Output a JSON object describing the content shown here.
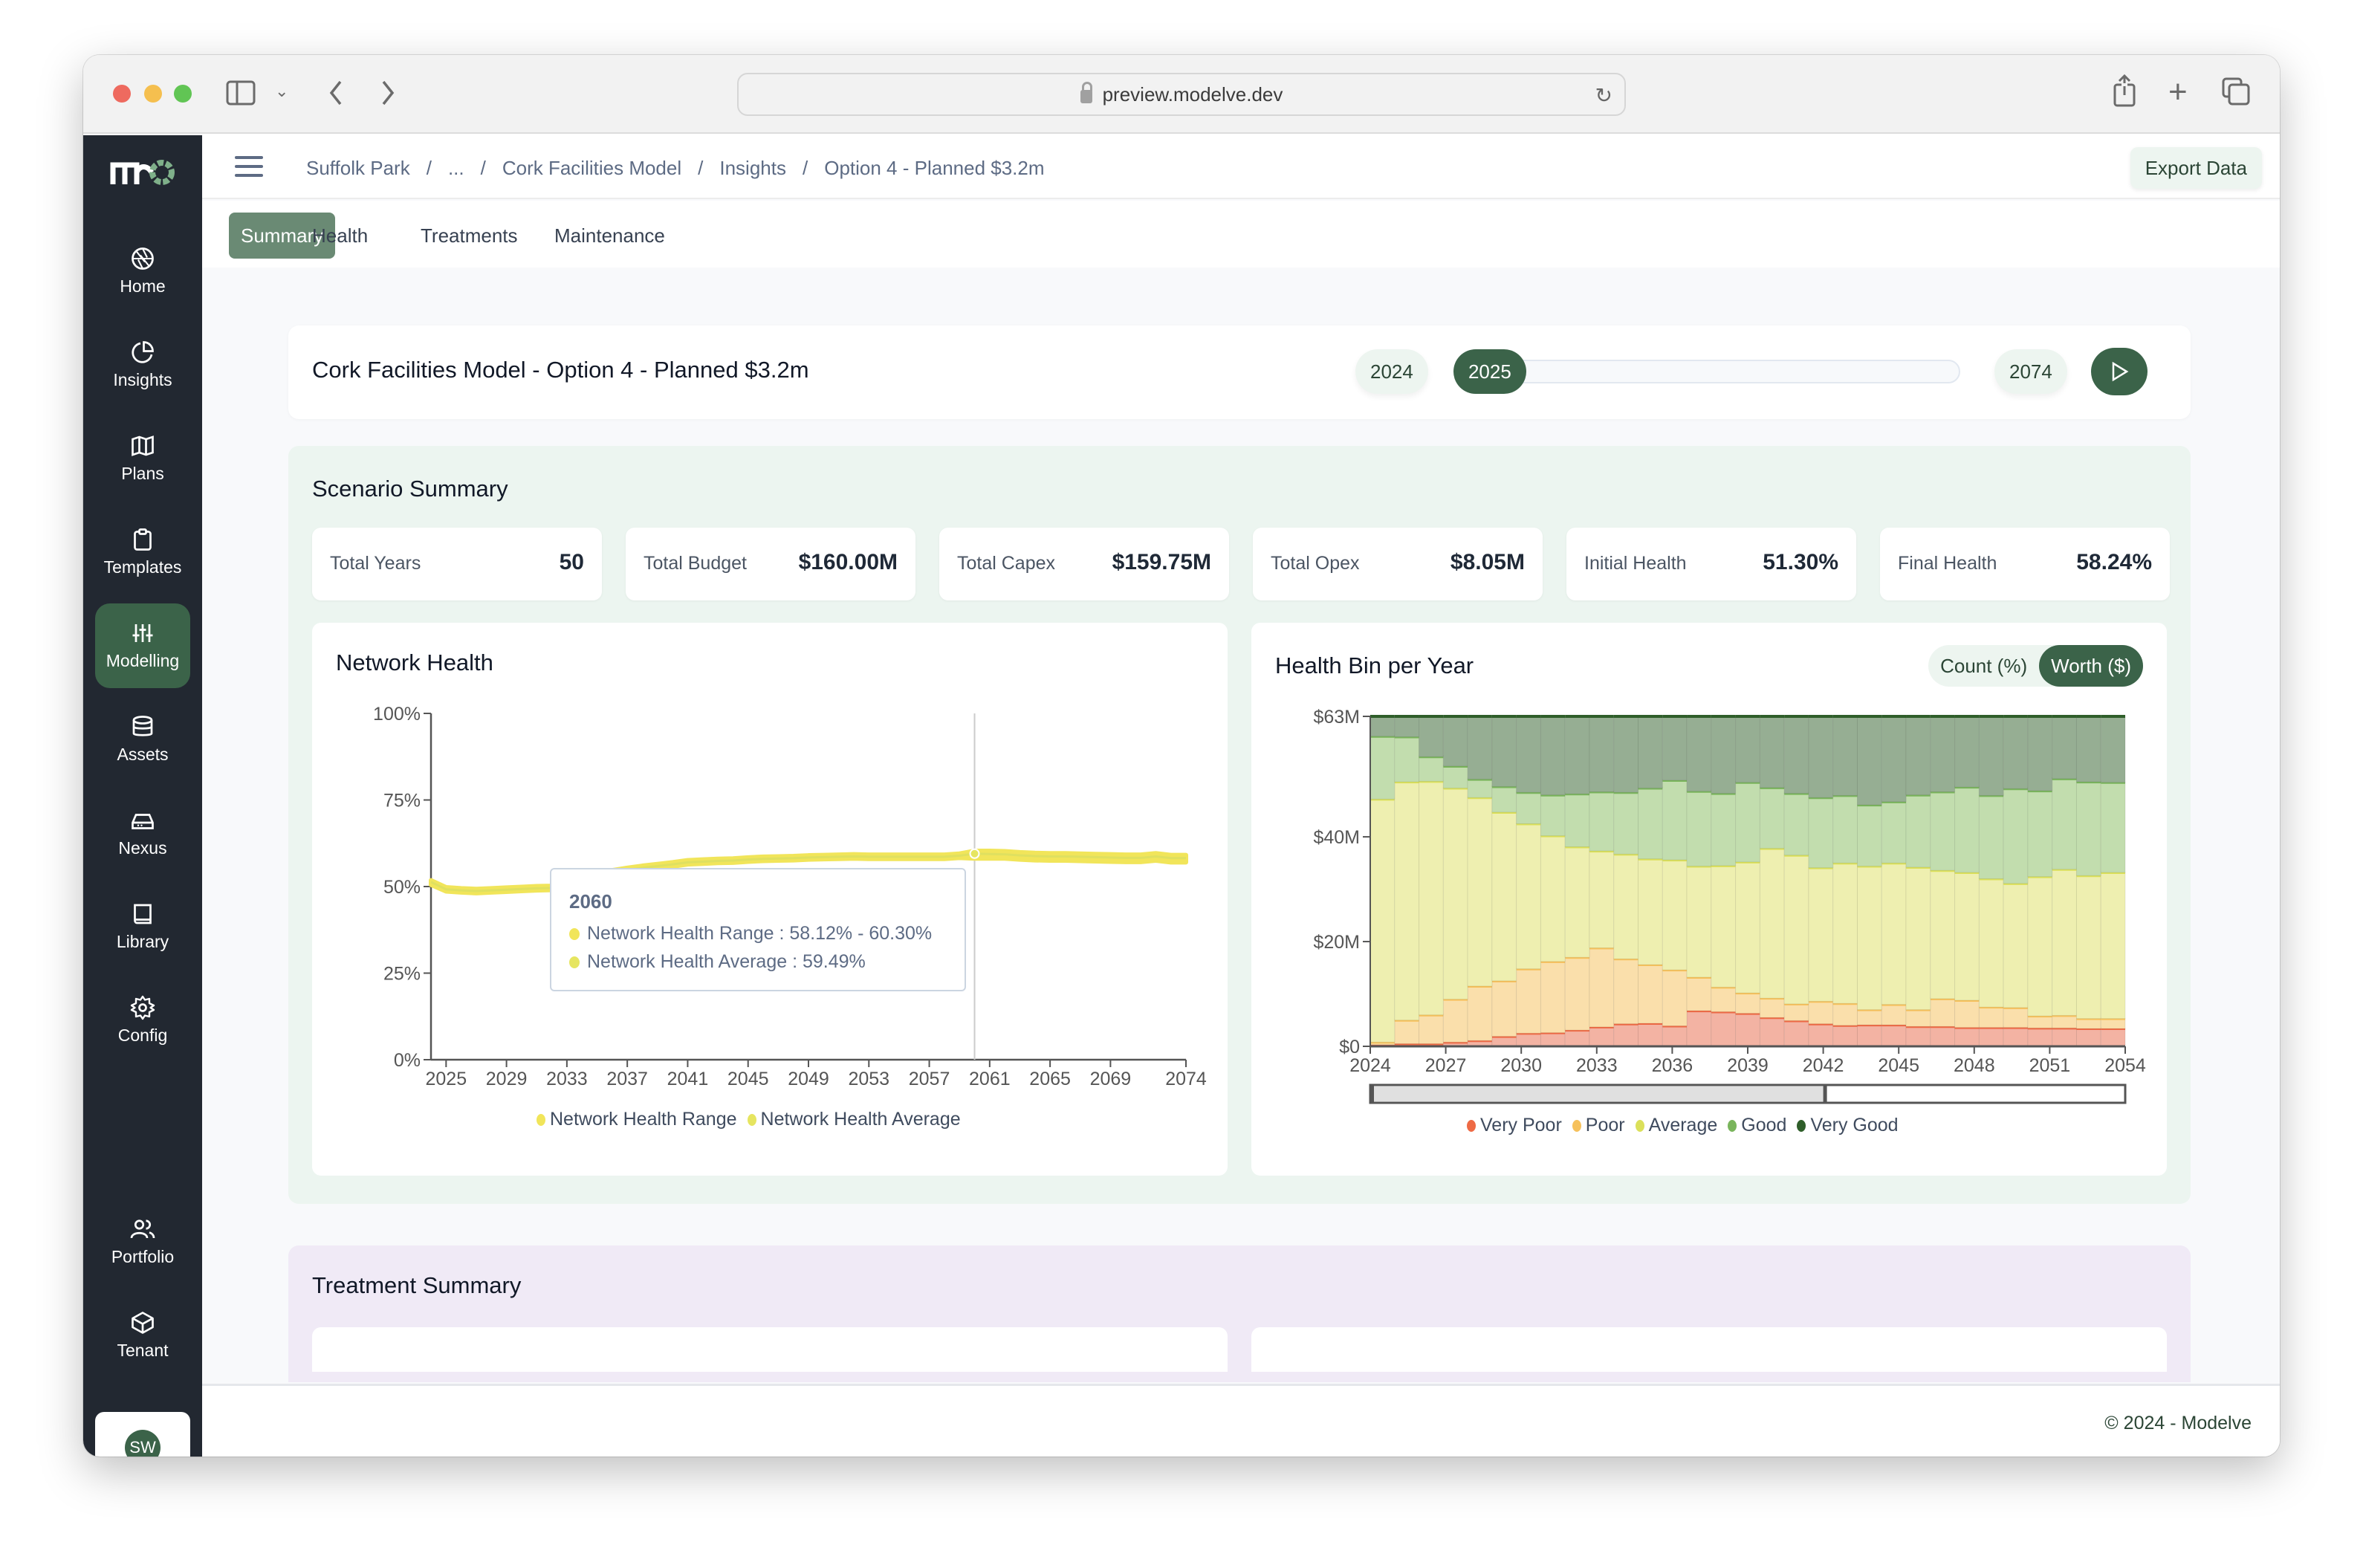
{
  "browser": {
    "url": "preview.modelve.dev"
  },
  "sidebar": {
    "logo": "mo",
    "items": [
      {
        "label": "Home",
        "icon": "aperture-icon"
      },
      {
        "label": "Insights",
        "icon": "pie-chart-icon"
      },
      {
        "label": "Plans",
        "icon": "map-icon"
      },
      {
        "label": "Templates",
        "icon": "clipboard-icon"
      },
      {
        "label": "Modelling",
        "icon": "sliders-icon",
        "active": true
      },
      {
        "label": "Assets",
        "icon": "database-icon"
      },
      {
        "label": "Nexus",
        "icon": "hard-drive-icon"
      },
      {
        "label": "Library",
        "icon": "book-icon"
      },
      {
        "label": "Config",
        "icon": "gear-icon"
      }
    ],
    "bottom_items": [
      {
        "label": "Portfolio",
        "icon": "users-icon"
      },
      {
        "label": "Tenant",
        "icon": "box-icon"
      }
    ],
    "avatar_initials": "SW"
  },
  "breadcrumb": [
    "Suffolk Park",
    "...",
    "Cork Facilities Model",
    "Insights",
    "Option 4 - Planned $3.2m"
  ],
  "export_label": "Export Data",
  "tabs": [
    {
      "label": "Summary",
      "active": true
    },
    {
      "label": "Health"
    },
    {
      "label": "Treatments"
    },
    {
      "label": "Maintenance"
    }
  ],
  "header": {
    "title": "Cork Facilities Model - Option 4 - Planned $3.2m",
    "start_year": "2024",
    "current_year": "2025",
    "end_year": "2074",
    "timeline_progress": 0.02
  },
  "scenario_summary": {
    "title": "Scenario Summary",
    "stats": [
      {
        "label": "Total Years",
        "value": "50"
      },
      {
        "label": "Total Budget",
        "value": "$160.00M"
      },
      {
        "label": "Total Capex",
        "value": "$159.75M"
      },
      {
        "label": "Total Opex",
        "value": "$8.05M"
      },
      {
        "label": "Initial Health",
        "value": "51.30%"
      },
      {
        "label": "Final Health",
        "value": "58.24%"
      }
    ]
  },
  "network_health": {
    "title": "Network Health",
    "tooltip": {
      "year": "2060",
      "range_label": "Network Health Range : 58.12% - 60.30%",
      "average_label": "Network Health Average : 59.49%"
    }
  },
  "health_bin": {
    "title": "Health Bin per Year",
    "toggle": [
      {
        "label": "Count (%)",
        "active": false
      },
      {
        "label": "Worth ($)",
        "active": true
      }
    ]
  },
  "treatment_summary": {
    "title": "Treatment Summary"
  },
  "footer": {
    "copyright": "© 2024 - Modelve"
  },
  "chart_data": [
    {
      "type": "line",
      "title": "Network Health",
      "xlabel": "",
      "ylabel": "",
      "ylim": [
        0,
        100
      ],
      "y_ticks": [
        "0%",
        "25%",
        "50%",
        "75%",
        "100%"
      ],
      "x_ticks": [
        "2025",
        "2029",
        "2033",
        "2037",
        "2041",
        "2045",
        "2049",
        "2053",
        "2057",
        "2061",
        "2065",
        "2069",
        "2074"
      ],
      "x": [
        2024,
        2025,
        2026,
        2027,
        2028,
        2029,
        2030,
        2031,
        2032,
        2033,
        2034,
        2035,
        2036,
        2037,
        2038,
        2039,
        2040,
        2041,
        2042,
        2043,
        2044,
        2045,
        2046,
        2047,
        2048,
        2049,
        2050,
        2051,
        2052,
        2053,
        2054,
        2055,
        2056,
        2057,
        2058,
        2059,
        2060,
        2061,
        2062,
        2063,
        2064,
        2065,
        2066,
        2067,
        2068,
        2069,
        2070,
        2071,
        2072,
        2073,
        2074
      ],
      "series": [
        {
          "name": "Network Health Range",
          "color": "#f1e55a",
          "low": [
            50.5,
            48.6,
            48.3,
            48.1,
            48.3,
            48.5,
            48.7,
            48.9,
            49.0,
            50.5,
            51.7,
            52.6,
            53.5,
            54.2,
            54.8,
            55.3,
            55.8,
            56.4,
            56.6,
            56.8,
            56.9,
            57.2,
            57.4,
            57.5,
            57.6,
            57.8,
            57.9,
            58.0,
            58.1,
            58.0,
            58.0,
            58.0,
            58.0,
            58.0,
            58.0,
            58.3,
            58.1,
            58.1,
            58.1,
            57.8,
            57.6,
            57.5,
            57.5,
            57.4,
            57.3,
            57.2,
            57.1,
            57.1,
            57.5,
            57.0,
            57.0
          ],
          "high": [
            51.8,
            49.8,
            49.5,
            49.3,
            49.5,
            49.7,
            49.9,
            50.1,
            50.2,
            51.7,
            52.9,
            53.8,
            54.7,
            55.4,
            56.0,
            56.5,
            57.0,
            57.6,
            57.8,
            58.0,
            58.1,
            58.4,
            58.6,
            58.7,
            58.8,
            59.0,
            59.1,
            59.2,
            59.3,
            59.2,
            59.2,
            59.2,
            59.2,
            59.2,
            59.2,
            59.5,
            60.3,
            60.3,
            60.2,
            59.9,
            59.7,
            59.6,
            59.6,
            59.5,
            59.4,
            59.3,
            59.2,
            59.2,
            59.6,
            59.1,
            59.1
          ]
        },
        {
          "name": "Network Health Average",
          "color": "#dfe060",
          "values": [
            51.3,
            49.2,
            48.9,
            48.7,
            48.9,
            49.1,
            49.3,
            49.5,
            49.6,
            51.1,
            52.3,
            53.2,
            54.1,
            54.8,
            55.4,
            55.9,
            56.4,
            57.0,
            57.2,
            57.4,
            57.5,
            57.8,
            58.0,
            58.1,
            58.2,
            58.4,
            58.5,
            58.6,
            58.7,
            58.6,
            58.6,
            58.6,
            58.6,
            58.6,
            58.6,
            58.9,
            59.49,
            59.4,
            59.3,
            59.0,
            58.8,
            58.7,
            58.7,
            58.6,
            58.5,
            58.4,
            58.3,
            58.3,
            58.7,
            58.24,
            58.24
          ]
        }
      ],
      "hover_year": 2060,
      "legend": [
        "Network Health Range",
        "Network Health Average"
      ],
      "legend_position": "bottom",
      "grid": false
    },
    {
      "type": "bar",
      "stacked": true,
      "title": "Health Bin per Year",
      "xlabel": "",
      "ylabel": "",
      "ylim": [
        0,
        63
      ],
      "unit": "$M",
      "y_ticks": [
        "$0",
        "$20M",
        "$40M",
        "$63M"
      ],
      "y_tick_values": [
        0,
        20,
        40,
        63
      ],
      "x_ticks": [
        "2024",
        "2027",
        "2030",
        "2033",
        "2036",
        "2039",
        "2042",
        "2045",
        "2048",
        "2051",
        "2054"
      ],
      "categories": [
        "2024",
        "2025",
        "2026",
        "2027",
        "2028",
        "2029",
        "2030",
        "2031",
        "2032",
        "2033",
        "2034",
        "2035",
        "2036",
        "2037",
        "2038",
        "2039",
        "2040",
        "2041",
        "2042",
        "2043",
        "2044",
        "2045",
        "2046",
        "2047",
        "2048",
        "2049",
        "2050",
        "2051",
        "2052",
        "2053",
        "2054"
      ],
      "series": [
        {
          "name": "Very Poor",
          "color": "#ee6a45",
          "fill": "#f3b3a3",
          "values": [
            0.3,
            0.5,
            0.5,
            0.8,
            1.1,
            1.9,
            2.5,
            2.6,
            3.1,
            3.7,
            4.3,
            4.4,
            3.9,
            6.8,
            6.6,
            6.3,
            5.5,
            4.9,
            4.3,
            4.0,
            4.1,
            4.1,
            3.8,
            3.8,
            3.6,
            3.6,
            3.6,
            3.5,
            3.5,
            3.4,
            3.4
          ]
        },
        {
          "name": "Poor",
          "color": "#f6c15c",
          "fill": "#fadfab",
          "values": [
            0.5,
            4.5,
            5.5,
            8.2,
            10.4,
            10.6,
            12.3,
            13.6,
            13.9,
            15.1,
            12.4,
            11.2,
            10.7,
            6.4,
            4.7,
            3.9,
            3.7,
            3.2,
            4.3,
            4.2,
            2.9,
            3.9,
            3.2,
            5.3,
            5.2,
            3.9,
            3.8,
            2.3,
            2.4,
            1.9,
            1.9
          ]
        },
        {
          "name": "Average",
          "color": "#dbe05a",
          "fill": "#eeefb0",
          "values": [
            46.4,
            45.5,
            44.6,
            40.3,
            36.0,
            32.2,
            27.7,
            24.0,
            21.1,
            18.5,
            20.0,
            20.2,
            21.0,
            21.2,
            23.2,
            25.0,
            28.6,
            28.4,
            25.5,
            26.8,
            27.4,
            27.0,
            27.2,
            24.5,
            24.4,
            24.5,
            23.7,
            26.6,
            27.9,
            27.3,
            27.9
          ]
        },
        {
          "name": "Good",
          "color": "#7ab55c",
          "fill": "#c2ddae",
          "values": [
            12.0,
            8.6,
            4.7,
            4.2,
            3.5,
            4.9,
            6.0,
            7.8,
            10.1,
            11.3,
            11.8,
            13.5,
            15.2,
            14.3,
            13.8,
            15.2,
            11.6,
            11.8,
            13.4,
            12.9,
            11.7,
            11.7,
            13.8,
            15.0,
            16.3,
            15.9,
            18.1,
            16.4,
            17.3,
            17.9,
            17.2
          ]
        },
        {
          "name": "Very Good",
          "color": "#2f5e2a",
          "fill": "#96ae93",
          "values": [
            3.8,
            3.9,
            7.7,
            9.5,
            12.0,
            13.4,
            14.5,
            15.0,
            14.8,
            14.4,
            14.5,
            13.7,
            12.2,
            14.3,
            14.7,
            12.6,
            13.6,
            14.7,
            15.5,
            15.1,
            16.9,
            16.3,
            15.0,
            14.4,
            13.5,
            15.1,
            13.8,
            14.2,
            11.9,
            12.5,
            12.6
          ]
        }
      ],
      "legend": [
        "Very Poor",
        "Poor",
        "Average",
        "Good",
        "Very Good"
      ],
      "legend_position": "bottom",
      "range_selector": {
        "start": "2024",
        "end": "2054",
        "selected_fraction": 0.6
      },
      "grid": false
    }
  ]
}
